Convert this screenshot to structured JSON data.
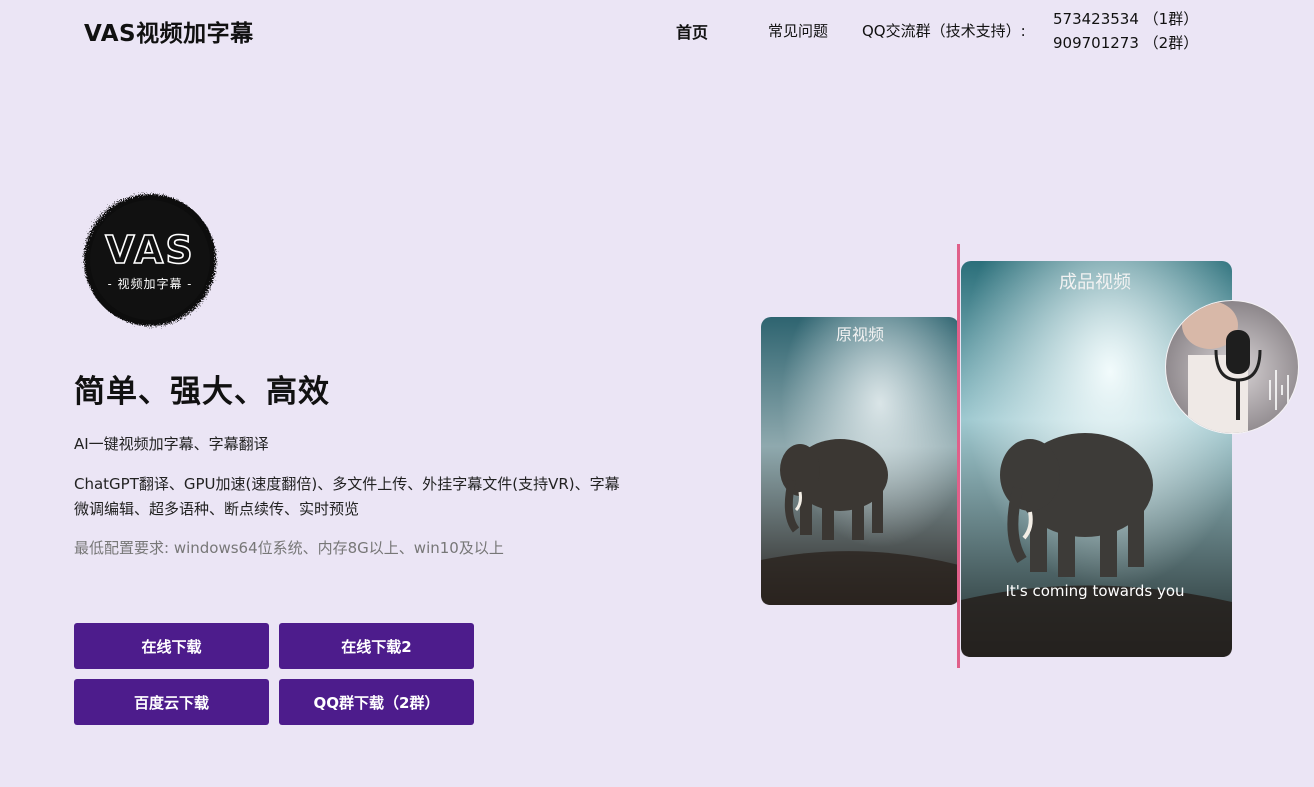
{
  "header": {
    "brand": "VAS视频加字幕",
    "nav_home": "首页",
    "nav_faq": "常见问题",
    "qq_label": "QQ交流群（技术支持）:",
    "qq_groups": [
      "573423534 （1群）",
      "909701273 （2群）"
    ]
  },
  "hero": {
    "logo_text": "VAS",
    "logo_subtitle": "- 视频加字幕 -",
    "headline": "简单、强大、高效",
    "subline": "AI一键视频加字幕、字幕翻译",
    "features": "ChatGPT翻译、GPU加速(速度翻倍)、多文件上传、外挂字幕文件(支持VR)、字幕微调编辑、超多语种、断点续传、实时预览",
    "requirement": "最低配置要求: windows64位系统、内存8G以上、win10及以上"
  },
  "buttons": {
    "download_online": "在线下载",
    "download_online2": "在线下载2",
    "download_baidu": "百度云下载",
    "download_qq": "QQ群下载（2群）"
  },
  "showcase": {
    "original_label": "原视频",
    "result_label": "成品视频",
    "subtitle_text": "It's coming towards you"
  },
  "colors": {
    "background": "#ebe5f5",
    "button": "#4d1c8c",
    "divider": "#e0608a"
  }
}
